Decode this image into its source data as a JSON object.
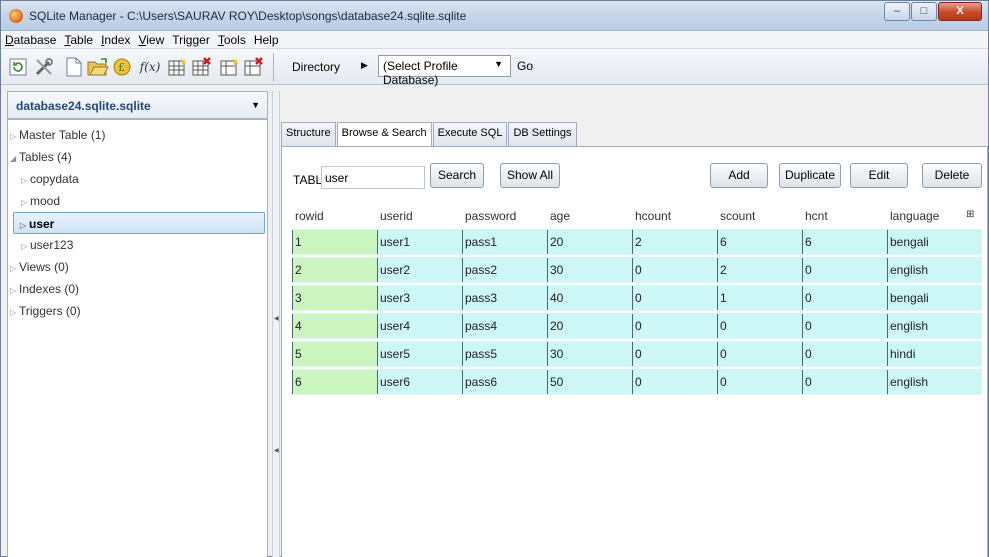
{
  "window": {
    "title": "SQLite Manager - C:\\Users\\SAURAV ROY\\Desktop\\songs\\database24.sqlite.sqlite",
    "controls": {
      "minimize": "–",
      "maximize": "□",
      "close": "X"
    }
  },
  "menu": [
    {
      "label": "Database",
      "u": "D",
      "rest": "atabase"
    },
    {
      "label": "Table",
      "u": "T",
      "rest": "able"
    },
    {
      "label": "Index",
      "u": "I",
      "rest": "ndex"
    },
    {
      "label": "View",
      "u": "V",
      "rest": "iew"
    },
    {
      "label": "Trigger",
      "u": "",
      "rest": "Trigger"
    },
    {
      "label": "Tools",
      "u": "T",
      "rest": "ools"
    },
    {
      "label": "Help",
      "u": "",
      "rest": "Help"
    }
  ],
  "toolbar": {
    "directory_label": "Directory",
    "profile_select": "(Select Profile Database)",
    "go_label": "Go",
    "fx_label": "f(x)"
  },
  "left": {
    "database": "database24.sqlite.sqlite",
    "tree": [
      {
        "label": "Master Table (1)",
        "indent": 0,
        "tri": "▷",
        "selected": false
      },
      {
        "label": "Tables (4)",
        "indent": 0,
        "tri": "◢",
        "selected": false
      },
      {
        "label": "copydata",
        "indent": 1,
        "tri": "▷",
        "selected": false
      },
      {
        "label": "mood",
        "indent": 1,
        "tri": "▷",
        "selected": false
      },
      {
        "label": "user",
        "indent": 1,
        "tri": "▷",
        "selected": true
      },
      {
        "label": "user123",
        "indent": 1,
        "tri": "▷",
        "selected": false
      },
      {
        "label": "Views (0)",
        "indent": 0,
        "tri": "▷",
        "selected": false
      },
      {
        "label": "Indexes (0)",
        "indent": 0,
        "tri": "▷",
        "selected": false
      },
      {
        "label": "Triggers (0)",
        "indent": 0,
        "tri": "▷",
        "selected": false
      }
    ]
  },
  "tabs": [
    {
      "label": "Structure",
      "active": false
    },
    {
      "label": "Browse & Search",
      "active": true
    },
    {
      "label": "Execute SQL",
      "active": false
    },
    {
      "label": "DB Settings",
      "active": false
    }
  ],
  "browse": {
    "table_label": "TABLE",
    "table_value": "user",
    "buttons": {
      "search": "Search",
      "show_all": "Show All",
      "add": "Add",
      "duplicate": "Duplicate",
      "edit": "Edit",
      "delete": "Delete"
    }
  },
  "grid": {
    "columns": [
      "rowid",
      "userid",
      "password",
      "age",
      "hcount",
      "scount",
      "hcnt",
      "language"
    ],
    "rows": [
      [
        "1",
        "user1",
        "pass1",
        "20",
        "2",
        "6",
        "6",
        "bengali"
      ],
      [
        "2",
        "user2",
        "pass2",
        "30",
        "0",
        "2",
        "0",
        "english"
      ],
      [
        "3",
        "user3",
        "pass3",
        "40",
        "0",
        "1",
        "0",
        "bengali"
      ],
      [
        "4",
        "user4",
        "pass4",
        "20",
        "0",
        "0",
        "0",
        "english"
      ],
      [
        "5",
        "user5",
        "pass5",
        "30",
        "0",
        "0",
        "0",
        "hindi"
      ],
      [
        "6",
        "user6",
        "pass6",
        "50",
        "0",
        "0",
        "0",
        "english"
      ]
    ]
  },
  "colors": {
    "row_bg": "#cdf7f7",
    "rowid_bg": "#ccf5bf",
    "selected_tree_bg": "#cfe2f8"
  }
}
